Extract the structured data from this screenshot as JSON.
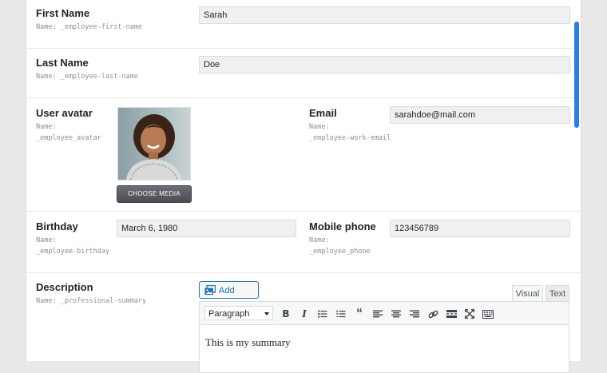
{
  "fields": {
    "first_name": {
      "label": "First Name",
      "meta": "Name: _employee-first-name",
      "value": "Sarah"
    },
    "last_name": {
      "label": "Last Name",
      "meta": "Name: _employee-last-name",
      "value": "Doe"
    },
    "avatar": {
      "label": "User avatar",
      "meta_1": "Name:",
      "meta_2": "_employee_avatar",
      "button": "CHOOSE MEDIA"
    },
    "email": {
      "label": "Email",
      "meta_1": "Name:",
      "meta_2": "_employee-work-email",
      "value": "sarahdoe@mail.com"
    },
    "birthday": {
      "label": "Birthday",
      "meta_1": "Name:",
      "meta_2": "_employee-birthday",
      "value": "March 6, 1980"
    },
    "mobile": {
      "label": "Mobile phone",
      "meta_1": "Name:",
      "meta_2": "_employee_phone",
      "value": "123456789"
    },
    "description": {
      "label": "Description",
      "meta": "Name: _professional-summary",
      "add_media": "Add media",
      "tab_visual": "Visual",
      "tab_text": "Text",
      "format": "Paragraph",
      "content": "This is my summary"
    }
  },
  "toolbar_icons": [
    "bold-icon",
    "italic-icon",
    "bullet-list-icon",
    "numbered-list-icon",
    "blockquote-icon",
    "align-left-icon",
    "align-center-icon",
    "align-right-icon",
    "link-icon",
    "read-more-icon",
    "fullscreen-icon",
    "toolbar-toggle-icon"
  ],
  "colors": {
    "accent": "#2271b1",
    "scrollbar": "#2b7de9",
    "input_bg": "#f0f0f1"
  }
}
